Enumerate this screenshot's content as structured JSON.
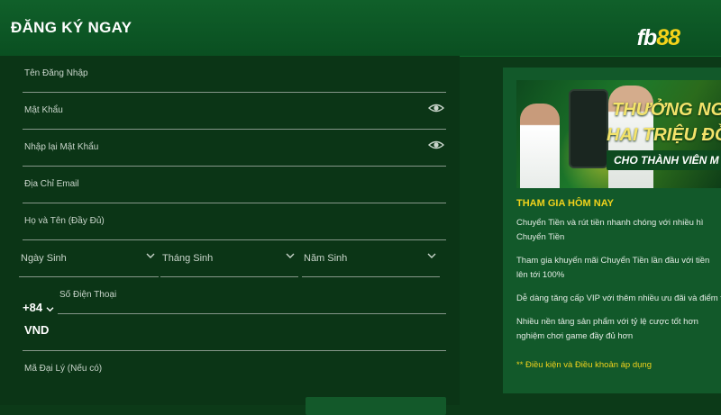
{
  "header": {
    "title": "ĐĂNG KÝ NGAY",
    "logo_main": "fb",
    "logo_accent": "88"
  },
  "form": {
    "username_label": "Tên Đăng Nhập",
    "password_label": "Mật Khẩu",
    "confirm_password_label": "Nhập lại Mật Khẩu",
    "email_label": "Địa Chỉ Email",
    "fullname_label": "Họ và Tên (Đầy Đủ)",
    "birth_day_label": "Ngày Sinh",
    "birth_month_label": "Tháng Sinh",
    "birth_year_label": "Năm Sinh",
    "country_code": "+84",
    "phone_label": "Số Điện Thoại",
    "currency_value": "VND",
    "agent_code_label": "Mã Đại Lý (Nếu có)"
  },
  "promo": {
    "banner_line1": "THƯỞNG NGA",
    "banner_line2": "HAI TRIỆU ĐỒ",
    "banner_line3": "CHO THÀNH VIÊN M",
    "title": "THAM GIA HÔM NAY",
    "items": [
      {
        "line1": "Chuyển Tiền và rút tiền nhanh chóng với nhiều hì",
        "line2": "Chuyển Tiền"
      },
      {
        "line1": "Tham gia khuyến mãi Chuyển Tiền lần đầu với tiền",
        "line2": "lên tới 100%"
      },
      {
        "line1": "Dễ dàng tăng cấp VIP với thêm nhiều ưu đãi và điểm t",
        "line2": ""
      },
      {
        "line1": "Nhiều nền tảng sản phẩm với tỷ lệ cược tốt hơn",
        "line2": "nghiệm chơi game đầy đủ hơn"
      }
    ],
    "terms": "** Điều kiện và Điều khoản áp dụng"
  },
  "colors": {
    "header_bg": "#0a4f21",
    "page_bg": "#0c3a18",
    "accent_yellow": "#f0d21c"
  }
}
